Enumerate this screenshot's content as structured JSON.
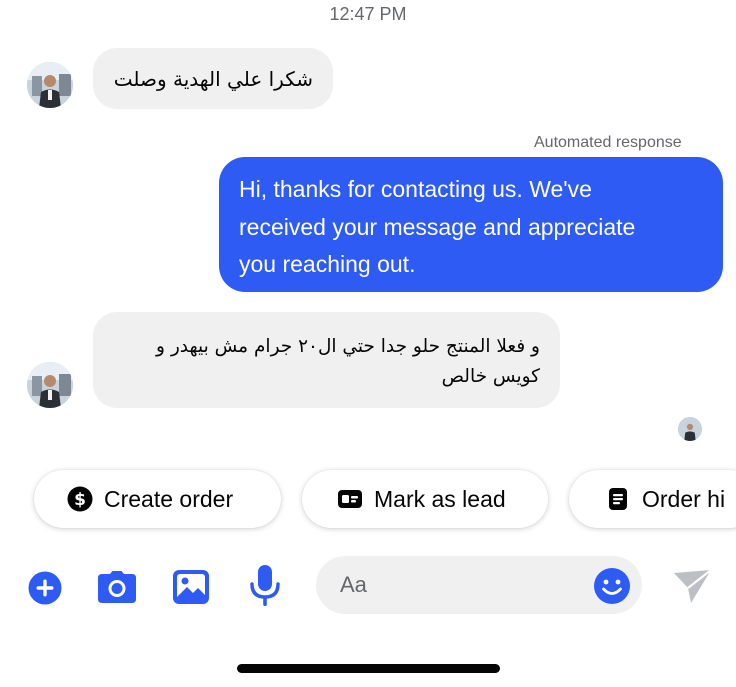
{
  "header": {
    "timestamp": "12:47 PM"
  },
  "messages": [
    {
      "direction": "incoming",
      "lines": [
        "شكرا علي الهدية وصلت"
      ]
    },
    {
      "direction": "outgoing",
      "label": "Automated response",
      "lines": [
        "Hi, thanks for contacting us. We've",
        "received your message and appreciate",
        "you reaching out."
      ]
    },
    {
      "direction": "incoming",
      "lines": [
        "و فعلا المنتج حلو جدا حتي ال٢٠ جرام مش بيهدر و",
        "كويس خالص"
      ]
    }
  ],
  "quick_actions": [
    {
      "label": "Create order",
      "icon": "dollar-circle-icon"
    },
    {
      "label": "Mark as lead",
      "icon": "id-card-icon"
    },
    {
      "label": "Order hi",
      "icon": "document-list-icon"
    }
  ],
  "composer": {
    "placeholder": "Aa",
    "icons": [
      "plus-circle-icon",
      "camera-icon",
      "gallery-icon",
      "microphone-icon",
      "emoji-icon",
      "send-icon"
    ]
  },
  "colors": {
    "accent": "#2d5bf3",
    "incoming_bubble": "#f0f0f0",
    "secondary_text": "#65676b"
  }
}
